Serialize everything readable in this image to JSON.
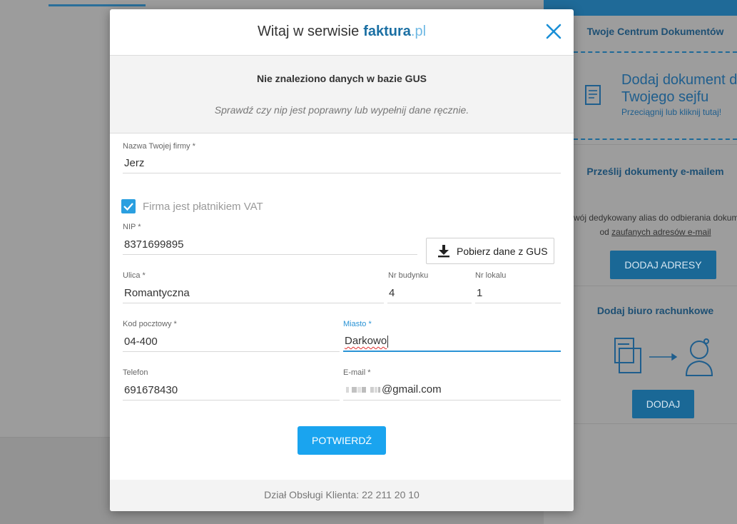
{
  "modal": {
    "title_prefix": "Witaj w serwisie",
    "brand_name": "faktura",
    "brand_tld": ".pl",
    "gus_message": "Nie znaleziono danych w bazie GUS",
    "gus_hint": "Sprawdź czy nip jest poprawny lub wypełnij dane ręcznie.",
    "fields": {
      "company_name": {
        "label": "Nazwa Twojej firmy",
        "value": "Jerz"
      },
      "vat_checkbox": {
        "label": "Firma jest płatnikiem VAT",
        "checked": true
      },
      "nip": {
        "label": "NIP",
        "value": "8371699895"
      },
      "street": {
        "label": "Ulica",
        "value": "Romantyczna"
      },
      "building_no": {
        "label": "Nr budynku",
        "value": "4"
      },
      "unit_no": {
        "label": "Nr lokalu",
        "value": "1"
      },
      "postal_code": {
        "label": "Kod pocztowy",
        "value": "04-400"
      },
      "city": {
        "label": "Miasto",
        "value": "Darkowo"
      },
      "phone": {
        "label": "Telefon",
        "value": "691678430"
      },
      "email": {
        "label": "E-mail",
        "value_visible": "@gmail.com"
      }
    },
    "required_marker": " *",
    "gus_button_label": "Pobierz dane z GUS",
    "confirm_button_label": "POTWIERDŹ",
    "footer": "Dział Obsługi Klienta: 22 211 20 10"
  },
  "sidebar": {
    "docs_center_title": "Twoje Centrum Dokumentów",
    "dropzone_title_line1": "Dodaj dokument d",
    "dropzone_title_line2": "Twojego sejfu",
    "dropzone_sub": "Przeciągnij lub kliknij tutaj!",
    "email_docs_title": "Prześlij dokumenty e-mailem",
    "email_docs_text1": "wój dedykowany alias do odbierania dokum",
    "email_docs_text2_prefix": "od ",
    "email_docs_text2_link": "zaufanych adresów e-mail",
    "add_addresses_button": "DODAJ ADRESY",
    "accounting_title": "Dodaj biuro rachunkowe",
    "add_button": "DODAJ"
  },
  "colors": {
    "accent": "#1aa4ef",
    "brand_dark": "#1a6fa3",
    "brand_light": "#6fb9e4",
    "sidebar_button": "#1a6896"
  },
  "icons": [
    "close-icon",
    "checkmark-icon",
    "download-icon",
    "document-icon",
    "folder-icon",
    "arrow-right-icon",
    "accountant-icon"
  ]
}
